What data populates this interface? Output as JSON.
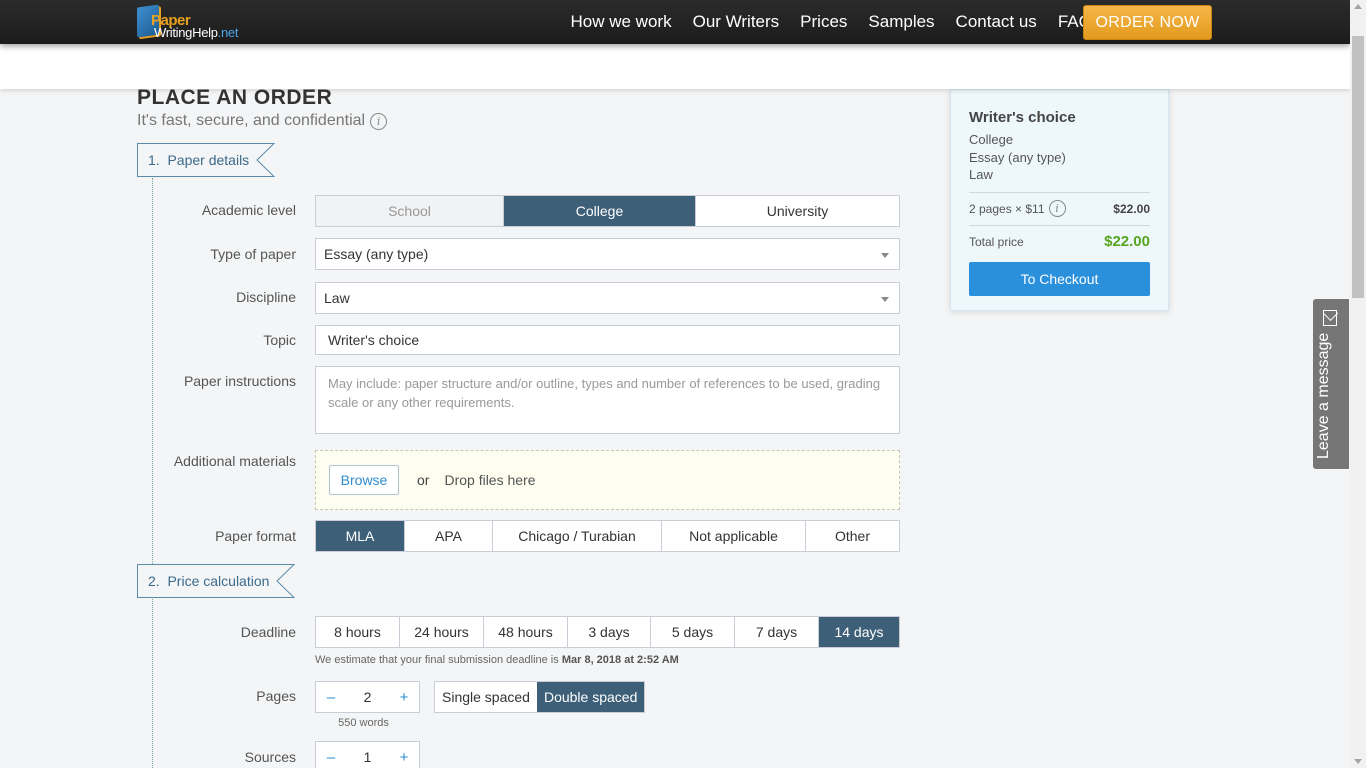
{
  "nav": {
    "logo_part1": "Paper",
    "logo_part2": "WritingHelp",
    "logo_part3": ".net",
    "items": [
      "How we work",
      "Our Writers",
      "Prices",
      "Samples",
      "Contact us",
      "FAQ"
    ],
    "order_now": "ORDER NOW"
  },
  "page": {
    "title": "PLACE AN ORDER",
    "subtitle": "It's fast, secure, and confidential"
  },
  "steps": [
    {
      "num": "1.",
      "label": "Paper details"
    },
    {
      "num": "2.",
      "label": "Price calculation"
    }
  ],
  "form": {
    "academic_level": {
      "label": "Academic level",
      "options": [
        "School",
        "College",
        "University"
      ],
      "selected": "College"
    },
    "type_of_paper": {
      "label": "Type of paper",
      "value": "Essay (any type)"
    },
    "discipline": {
      "label": "Discipline",
      "value": "Law"
    },
    "topic": {
      "label": "Topic",
      "value": "Writer's choice"
    },
    "instructions": {
      "label": "Paper instructions",
      "placeholder": "May include: paper structure and/or outline, types and number of references to be used, grading scale or any other requirements."
    },
    "materials": {
      "label": "Additional materials",
      "browse": "Browse",
      "or": "or",
      "drop": "Drop files here"
    },
    "paper_format": {
      "label": "Paper format",
      "options": [
        "MLA",
        "APA",
        "Chicago / Turabian",
        "Not applicable",
        "Other"
      ],
      "selected": "MLA"
    },
    "deadline": {
      "label": "Deadline",
      "options": [
        "8 hours",
        "24 hours",
        "48 hours",
        "3 days",
        "5 days",
        "7 days",
        "14 days"
      ],
      "selected": "14 days",
      "note_prefix": "We estimate that your final submission deadline is",
      "note_date": "Mar 8, 2018 at 2:52 AM"
    },
    "pages": {
      "label": "Pages",
      "minus": "–",
      "value": "2",
      "plus": "+",
      "words": "550 words",
      "spacing": [
        "Single spaced",
        "Double spaced"
      ],
      "spacing_selected": "Double spaced"
    },
    "sources": {
      "label": "Sources",
      "minus": "–",
      "value": "1",
      "plus": "+"
    }
  },
  "summary": {
    "topic": "Writer's choice",
    "level": "College",
    "type": "Essay (any type)",
    "discipline": "Law",
    "pages_line": "2 pages × $11",
    "pages_amount": "$22.00",
    "total_label": "Total price",
    "total_amount": "$22.00",
    "checkout": "To Checkout"
  },
  "widget": {
    "leave_message": "Leave a message"
  },
  "colors": {
    "active": "#3e5f78",
    "order_btn": "#e9a22b",
    "checkout_btn": "#2a90dc",
    "total_green": "#57a51e"
  }
}
